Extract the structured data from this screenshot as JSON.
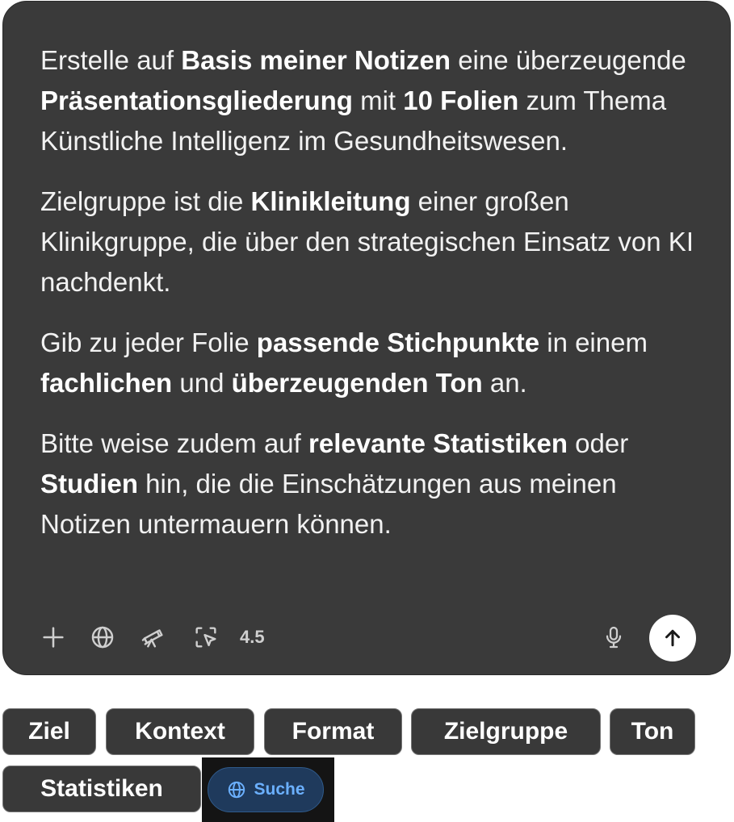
{
  "prompt": {
    "p1": [
      {
        "t": "Erstelle auf ",
        "b": false
      },
      {
        "t": "Basis meiner Notizen",
        "b": true
      },
      {
        "t": " eine überzeugende ",
        "b": false
      },
      {
        "t": "Präsentationsgliederung",
        "b": true
      },
      {
        "t": " mit ",
        "b": false
      },
      {
        "t": "10 Folien",
        "b": true
      },
      {
        "t": " zum Thema Künstliche Intelligenz im Gesundheitswesen.",
        "b": false
      }
    ],
    "p2": [
      {
        "t": "Zielgruppe ist die ",
        "b": false
      },
      {
        "t": "Klinikleitung",
        "b": true
      },
      {
        "t": " einer großen Klinikgruppe, die über den strategischen Einsatz von KI nachdenkt.",
        "b": false
      }
    ],
    "p3": [
      {
        "t": "Gib zu jeder Folie ",
        "b": false
      },
      {
        "t": "passende Stichpunkte",
        "b": true
      },
      {
        "t": " in einem ",
        "b": false
      },
      {
        "t": "fachlichen",
        "b": true
      },
      {
        "t": " und ",
        "b": false
      },
      {
        "t": "überzeugenden Ton",
        "b": true
      },
      {
        "t": " an.",
        "b": false
      }
    ],
    "p4": [
      {
        "t": "Bitte weise zudem auf ",
        "b": false
      },
      {
        "t": "relevante Statistiken",
        "b": true
      },
      {
        "t": " oder ",
        "b": false
      },
      {
        "t": "Studien",
        "b": true
      },
      {
        "t": " hin, die die Einschätzungen aus meinen Notizen untermauern können.",
        "b": false
      }
    ]
  },
  "toolbar": {
    "add_icon": "plus-icon",
    "web_icon": "globe-icon",
    "research_icon": "telescope-icon",
    "select_icon": "cursor-select-icon",
    "model_version": "4.5",
    "mic_icon": "microphone-icon",
    "send_icon": "arrow-up-icon"
  },
  "chips": {
    "ziel": "Ziel",
    "kontext": "Kontext",
    "format": "Format",
    "zielgruppe": "Zielgruppe",
    "ton": "Ton",
    "statistiken": "Statistiken"
  },
  "search_chip": {
    "label": "Suche",
    "icon": "globe-icon"
  },
  "colors": {
    "card": "#3a3a3a",
    "chip": "#393939",
    "search_bg": "#1f3a5c",
    "search_text": "#6bb0ff"
  }
}
